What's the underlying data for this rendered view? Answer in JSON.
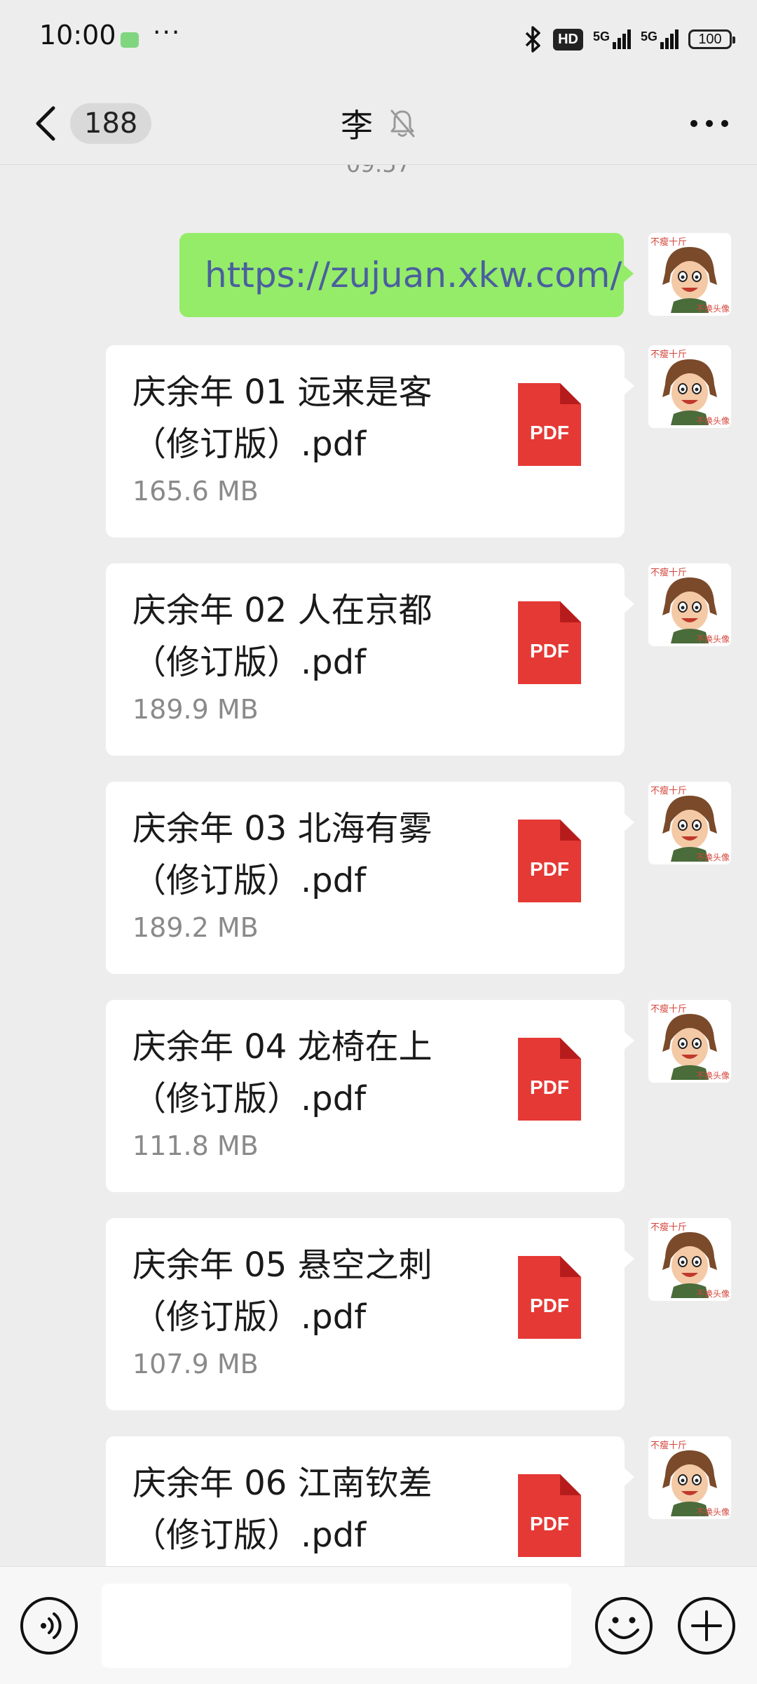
{
  "status_bar": {
    "time": "10:00",
    "dots": "···",
    "hd": "HD",
    "signal_1": "5G",
    "signal_2": "5G",
    "battery": "100"
  },
  "header": {
    "unread_count": "188",
    "title": "李",
    "muted": true
  },
  "messages": {
    "timestamp": "09:57",
    "link": "https://zujuan.xkw.com/",
    "avatar": {
      "caption_top": "不瘦十斤",
      "caption_bottom": "不换头像"
    },
    "files": [
      {
        "name": "庆余年 01 远来是客（修订版）.pdf",
        "size": "165.6 MB",
        "type": "PDF"
      },
      {
        "name": "庆余年 02 人在京都（修订版）.pdf",
        "size": "189.9 MB",
        "type": "PDF"
      },
      {
        "name": "庆余年 03 北海有雾（修订版）.pdf",
        "size": "189.2 MB",
        "type": "PDF"
      },
      {
        "name": "庆余年 04 龙椅在上（修订版）.pdf",
        "size": "111.8 MB",
        "type": "PDF"
      },
      {
        "name": "庆余年 05 悬空之刺（修订版）.pdf",
        "size": "107.9 MB",
        "type": "PDF"
      },
      {
        "name": "庆余年 06 江南钦差（修订版）.pdf",
        "size": "",
        "type": "PDF"
      }
    ]
  },
  "input_bar": {
    "text": ""
  },
  "colors": {
    "background": "#ededed",
    "sent_bubble": "#95ec69",
    "link_text": "#4a5f9e",
    "pdf_red": "#e53935"
  },
  "icons": [
    "back-icon",
    "mute-icon",
    "more-icon",
    "voice-icon",
    "emoji-icon",
    "plus-icon",
    "pdf-icon"
  ]
}
